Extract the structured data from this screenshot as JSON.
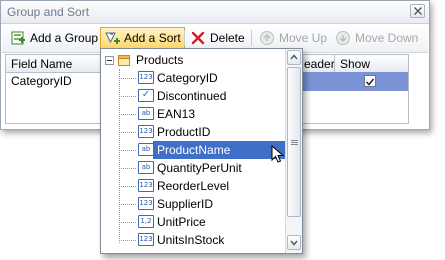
{
  "window": {
    "title": "Group and Sort"
  },
  "toolbar": {
    "add_group": "Add a Group",
    "add_sort": "Add a Sort",
    "delete": "Delete",
    "move_up": "Move Up",
    "move_down": "Move Down"
  },
  "grid": {
    "columns": [
      "Field Name",
      "eader",
      "Show Footer"
    ],
    "rows": [
      {
        "field_name": "CategoryID",
        "show_footer_checked": true
      }
    ]
  },
  "dropdown": {
    "root": "Products",
    "items": [
      {
        "label": "CategoryID",
        "type_icon": "123"
      },
      {
        "label": "Discontinued",
        "type_icon": "check"
      },
      {
        "label": "EAN13",
        "type_icon": "ab"
      },
      {
        "label": "ProductID",
        "type_icon": "123"
      },
      {
        "label": "ProductName",
        "type_icon": "ab",
        "selected": true
      },
      {
        "label": "QuantityPerUnit",
        "type_icon": "ab"
      },
      {
        "label": "ReorderLevel",
        "type_icon": "123"
      },
      {
        "label": "SupplierID",
        "type_icon": "123"
      },
      {
        "label": "UnitPrice",
        "type_icon": "1,2"
      },
      {
        "label": "UnitsInStock",
        "type_icon": "123"
      }
    ]
  },
  "icons": {
    "type_123": "123",
    "type_ab": "ab",
    "type_decimal": "1,2",
    "type_check": "✓"
  },
  "colors": {
    "selection": "#3f6fc6",
    "grid_selection": "#7b94d6",
    "active_button": "#ffd86e"
  }
}
